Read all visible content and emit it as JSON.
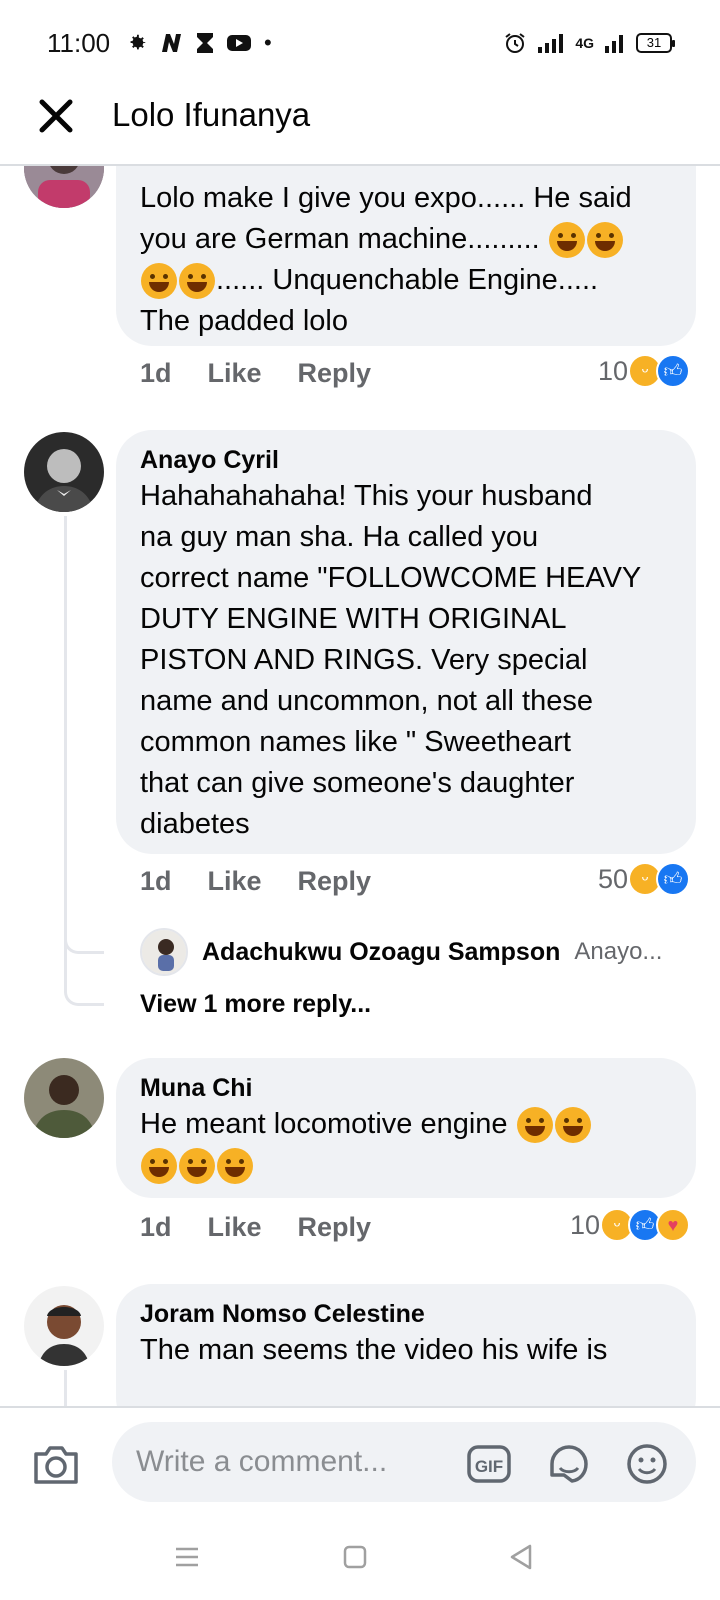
{
  "status_bar": {
    "time": "11:00",
    "left_icons": [
      "gear-icon",
      "n-icon",
      "hourglass-icon",
      "youtube-icon",
      "dot-icon"
    ],
    "network": "4G",
    "battery": "31"
  },
  "header": {
    "title": "Lolo Ifunanya",
    "close_icon": "close-icon"
  },
  "comments": [
    {
      "author": "",
      "text_lines": [
        "Lolo make I give you expo...... He said",
        "you are German machine.........",
        "...... Unquenchable Engine.....",
        "The padded lolo"
      ],
      "time": "1d",
      "like": "Like",
      "reply": "Reply",
      "reactions_count": "10",
      "reactions": [
        "haha",
        "like"
      ]
    },
    {
      "author": "Anayo Cyril",
      "text_lines": [
        "Hahahahahaha! This your husband",
        "na guy man sha. Ha called you",
        "correct name \"FOLLOWCOME HEAVY",
        "DUTY ENGINE WITH ORIGINAL",
        "PISTON AND RINGS. Very special",
        "name and uncommon, not all these",
        "common names like \" Sweetheart",
        "that can give someone's daughter",
        "diabetes"
      ],
      "time": "1d",
      "like": "Like",
      "reply": "Reply",
      "reactions_count": "50",
      "reactions": [
        "haha",
        "like"
      ],
      "reply_preview": {
        "author": "Adachukwu Ozoagu Sampson",
        "snippet": "Anayo..."
      },
      "more_replies": "View 1 more reply..."
    },
    {
      "author": "Muna Chi",
      "text_lines": [
        "He meant locomotive engine"
      ],
      "time": "1d",
      "like": "Like",
      "reply": "Reply",
      "reactions_count": "10",
      "reactions": [
        "haha",
        "like",
        "care"
      ]
    },
    {
      "author": "Joram Nomso Celestine",
      "text_lines": [
        "The man seems  the video his wife is"
      ]
    }
  ],
  "composer": {
    "placeholder": "Write a comment...",
    "gif_label": "GIF"
  }
}
